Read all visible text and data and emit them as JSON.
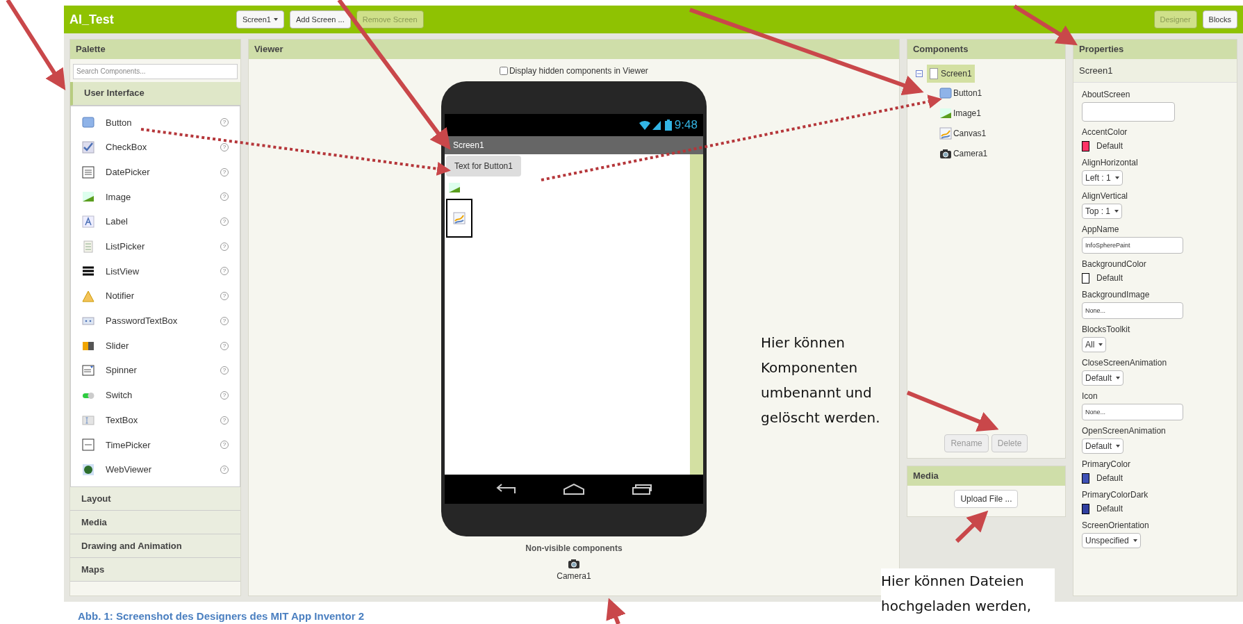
{
  "app_bar": {
    "title": "AI_Test",
    "screen_dropdown": "Screen1",
    "buttons": [
      {
        "label": "Add Screen ...",
        "disabled": false
      },
      {
        "label": "Remove Screen",
        "disabled": true
      }
    ],
    "view_tabs": [
      {
        "label": "Designer",
        "selected": true
      },
      {
        "label": "Blocks",
        "selected": false
      }
    ]
  },
  "palette": {
    "title": "Palette",
    "search": {
      "placeholder": "Search Components..."
    },
    "categories": [
      {
        "label": "User Interface",
        "expanded": true,
        "items": [
          {
            "label": "Button",
            "kind": "button",
            "help": "?"
          },
          {
            "label": "CheckBox",
            "kind": "checkbox",
            "help": "?"
          },
          {
            "label": "DatePicker",
            "kind": "datepicker",
            "help": "?"
          },
          {
            "label": "Image",
            "kind": "image",
            "help": "?"
          },
          {
            "label": "Label",
            "kind": "label",
            "help": "?"
          },
          {
            "label": "ListPicker",
            "kind": "listpicker",
            "help": "?"
          },
          {
            "label": "ListView",
            "kind": "listview",
            "help": "?"
          },
          {
            "label": "Notifier",
            "kind": "notifier",
            "help": "?"
          },
          {
            "label": "PasswordTextBox",
            "kind": "password",
            "help": "?"
          },
          {
            "label": "Slider",
            "kind": "slider",
            "help": "?"
          },
          {
            "label": "Spinner",
            "kind": "spinner",
            "help": "?"
          },
          {
            "label": "Switch",
            "kind": "switch",
            "help": "?"
          },
          {
            "label": "TextBox",
            "kind": "textbox",
            "help": "?"
          },
          {
            "label": "TimePicker",
            "kind": "timepicker",
            "help": "?"
          },
          {
            "label": "WebViewer",
            "kind": "webviewer",
            "help": "?"
          }
        ]
      },
      {
        "label": "Layout",
        "expanded": false
      },
      {
        "label": "Media",
        "expanded": false
      },
      {
        "label": "Drawing and Animation",
        "expanded": false
      },
      {
        "label": "Maps",
        "expanded": false
      }
    ]
  },
  "viewer": {
    "title": "Viewer",
    "hidden_checkbox": {
      "label": "Display hidden components in Viewer",
      "checked": false
    },
    "phone": {
      "status_time": "9:48",
      "screen_title": "Screen1",
      "widgets": [
        {
          "kind": "button",
          "text": "Text for Button1",
          "selected": false
        },
        {
          "kind": "image",
          "selected": false
        },
        {
          "kind": "canvas",
          "selected": true
        }
      ]
    },
    "non_visible": {
      "heading": "Non-visible components",
      "items": [
        {
          "label": "Camera1"
        }
      ]
    }
  },
  "components": {
    "title": "Components",
    "tree": {
      "label": "Screen1",
      "selected": true,
      "expanded": true,
      "children": [
        {
          "label": "Button1",
          "kind": "button",
          "selected": false
        },
        {
          "label": "Image1",
          "kind": "image",
          "selected": false
        },
        {
          "label": "Canvas1",
          "kind": "canvas",
          "selected": false
        },
        {
          "label": "Camera1",
          "kind": "camera",
          "selected": false
        }
      ]
    },
    "buttons": [
      {
        "label": "Rename",
        "disabled": true
      },
      {
        "label": "Delete",
        "disabled": true
      }
    ]
  },
  "media": {
    "title": "Media",
    "upload_button": "Upload File ..."
  },
  "properties": {
    "title": "Properties",
    "subject": "Screen1",
    "items": [
      {
        "name": "AboutScreen",
        "kind": "textarea"
      },
      {
        "name": "AccentColor",
        "kind": "color",
        "value": "Default",
        "color": "#ff3366"
      },
      {
        "name": "AlignHorizontal",
        "kind": "dropdown",
        "value": "Left : 1"
      },
      {
        "name": "AlignVertical",
        "kind": "dropdown",
        "value": "Top : 1"
      },
      {
        "name": "AppName",
        "kind": "text",
        "value": "InfoSpherePaint"
      },
      {
        "name": "BackgroundColor",
        "kind": "color",
        "value": "Default",
        "color": "#ffffff"
      },
      {
        "name": "BackgroundImage",
        "kind": "text",
        "value": "None..."
      },
      {
        "name": "BlocksToolkit",
        "kind": "dropdown",
        "value": "All"
      },
      {
        "name": "CloseScreenAnimation",
        "kind": "dropdown",
        "value": "Default"
      },
      {
        "name": "Icon",
        "kind": "text",
        "value": "None..."
      },
      {
        "name": "OpenScreenAnimation",
        "kind": "dropdown",
        "value": "Default"
      },
      {
        "name": "PrimaryColor",
        "kind": "color",
        "value": "Default",
        "color": "#3f51b5"
      },
      {
        "name": "PrimaryColorDark",
        "kind": "color",
        "value": "Default",
        "color": "#303f9f"
      },
      {
        "name": "ScreenOrientation",
        "kind": "dropdown",
        "value": "Unspecified"
      }
    ]
  },
  "annotations": {
    "notes": [
      "Hier können Komponenten umbenannt und gelöscht werden.",
      "Hier können Dateien hochgeladen werden,"
    ],
    "caption": "Abb. 1: Screenshot des Designers des MIT App Inventor 2"
  }
}
